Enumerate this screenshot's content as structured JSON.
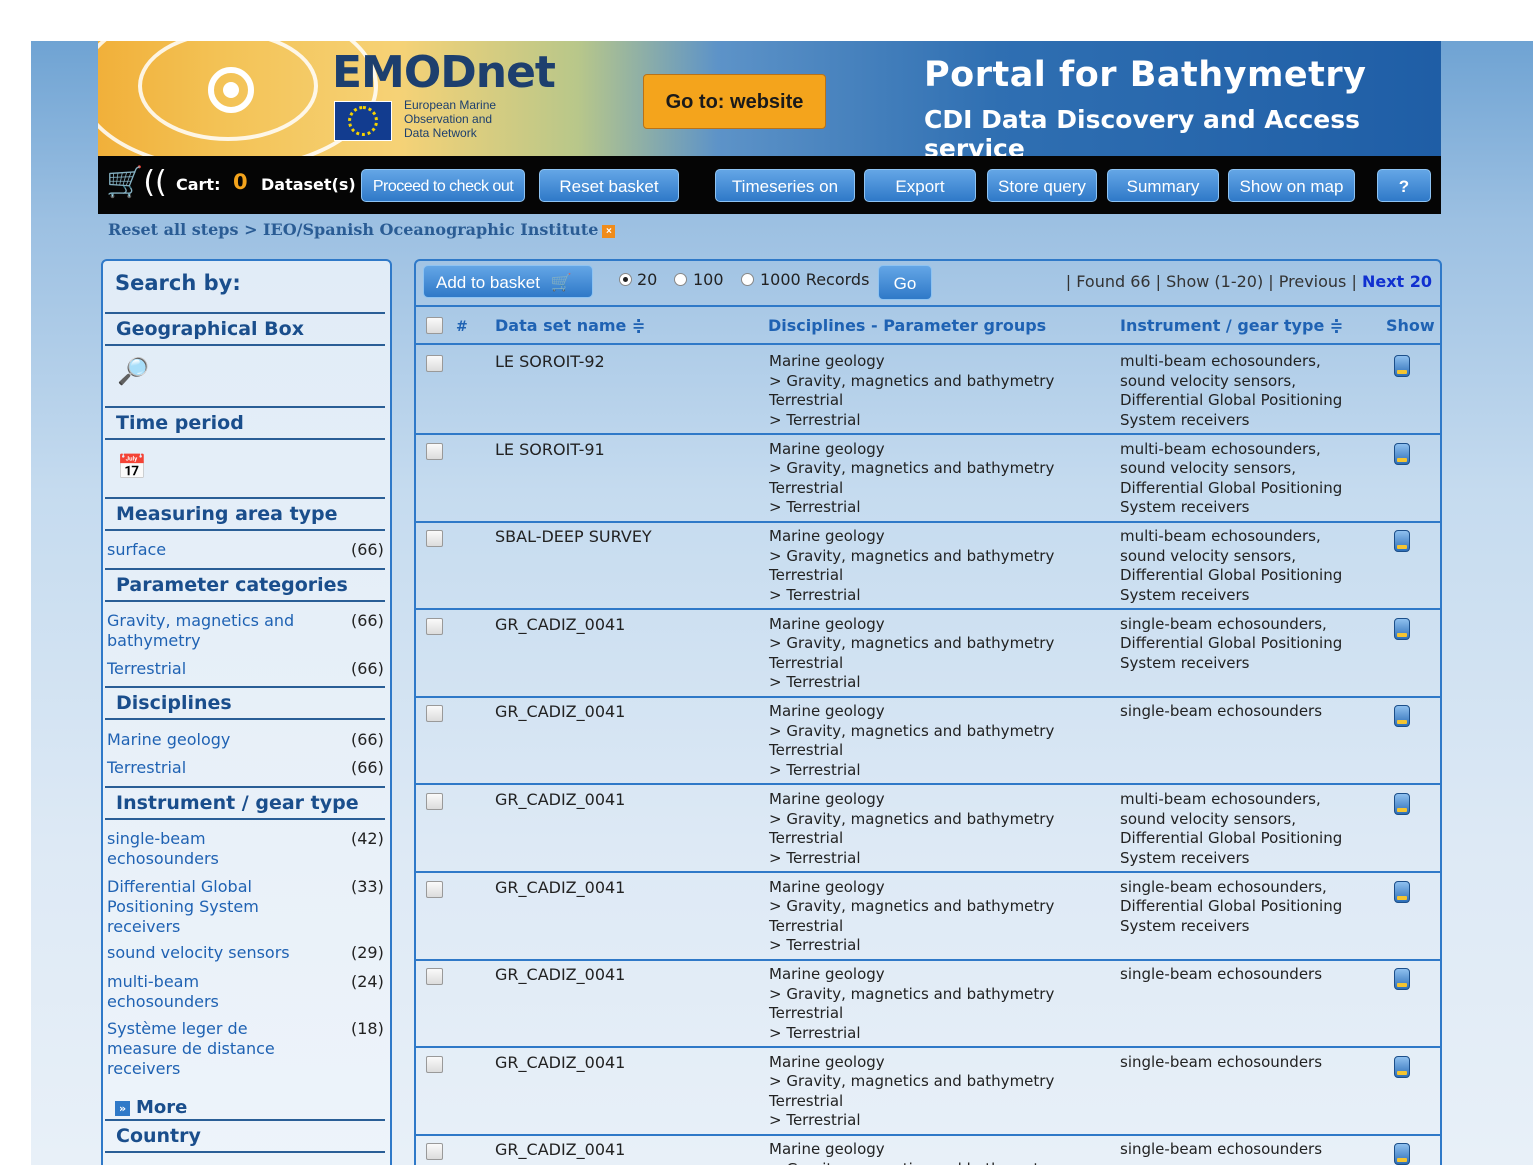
{
  "header": {
    "brand": "EMODnet",
    "brand_sub": "European Marine\nObservation and\nData Network",
    "goto_label": "Go to: website",
    "portal_title": "Portal for Bathymetry",
    "portal_sub": "CDI Data Discovery and Access service"
  },
  "toolbar": {
    "cart_label": "Cart:",
    "cart_count": "0",
    "datasets_label": "Dataset(s)",
    "buttons": [
      "Proceed to check out",
      "Reset basket",
      "Timeseries on",
      "Export",
      "Store query",
      "Summary",
      "Show on map",
      "?"
    ]
  },
  "breadcrumb": "Reset all steps > IEO/Spanish Oceanographic Institute",
  "sidebar": {
    "title": "Search by:",
    "geo_box": "Geographical Box",
    "time_period": "Time period",
    "measuring_area": "Measuring area type",
    "measuring_items": [
      {
        "label": "surface",
        "count": "(66)"
      }
    ],
    "param_categories": "Parameter categories",
    "param_items": [
      {
        "label": "Gravity, magnetics and\nbathymetry",
        "count": "(66)"
      },
      {
        "label": "Terrestrial",
        "count": "(66)"
      }
    ],
    "disciplines": "Disciplines",
    "discipline_items": [
      {
        "label": "Marine geology",
        "count": "(66)"
      },
      {
        "label": "Terrestrial",
        "count": "(66)"
      }
    ],
    "instrument": "Instrument / gear type",
    "instrument_items": [
      {
        "label": "single-beam\nechosounders",
        "count": "(42)"
      },
      {
        "label": "Differential Global\nPositioning System\nreceivers",
        "count": "(33)"
      },
      {
        "label": "sound velocity sensors",
        "count": "(29)"
      },
      {
        "label": "multi-beam\nechosounders",
        "count": "(24)"
      },
      {
        "label": "Système leger de\nmeasure de distance\nreceivers",
        "count": "(18)"
      }
    ],
    "more": "More",
    "country": "Country"
  },
  "results": {
    "add_basket": "Add to basket",
    "records": [
      {
        "label": "20",
        "selected": true
      },
      {
        "label": "100",
        "selected": false
      },
      {
        "label": "1000 Records",
        "selected": false
      }
    ],
    "go": "Go",
    "paging_found": "| Found 66 | Show  (1-20) | Previous |",
    "paging_next": "Next 20",
    "columns": {
      "num": "#",
      "name": "Data set name ≑",
      "disc": "Disciplines - Parameter groups",
      "inst": "Instrument / gear type ≑",
      "show": "Show"
    },
    "rows": [
      {
        "name": "LE SOROIT-92",
        "disc": "Marine geology\n> Gravity, magnetics and bathymetry\nTerrestrial\n> Terrestrial",
        "inst": "multi-beam echosounders,\nsound velocity sensors,\nDifferential Global Positioning\nSystem receivers"
      },
      {
        "name": "LE SOROIT-91",
        "disc": "Marine geology\n> Gravity, magnetics and bathymetry\nTerrestrial\n> Terrestrial",
        "inst": "multi-beam echosounders,\nsound velocity sensors,\nDifferential Global Positioning\nSystem receivers"
      },
      {
        "name": "SBAL-DEEP SURVEY",
        "disc": "Marine geology\n> Gravity, magnetics and bathymetry\nTerrestrial\n> Terrestrial",
        "inst": "multi-beam echosounders,\nsound velocity sensors,\nDifferential Global Positioning\nSystem receivers"
      },
      {
        "name": "GR_CADIZ_0041",
        "disc": "Marine geology\n> Gravity, magnetics and bathymetry\nTerrestrial\n> Terrestrial",
        "inst": "single-beam echosounders,\nDifferential Global Positioning\nSystem receivers"
      },
      {
        "name": "GR_CADIZ_0041",
        "disc": "Marine geology\n> Gravity, magnetics and bathymetry\nTerrestrial\n> Terrestrial",
        "inst": "single-beam echosounders"
      },
      {
        "name": "GR_CADIZ_0041",
        "disc": "Marine geology\n> Gravity, magnetics and bathymetry\nTerrestrial\n> Terrestrial",
        "inst": "multi-beam echosounders,\nsound velocity sensors,\nDifferential Global Positioning\nSystem receivers"
      },
      {
        "name": "GR_CADIZ_0041",
        "disc": "Marine geology\n> Gravity, magnetics and bathymetry\nTerrestrial\n> Terrestrial",
        "inst": "single-beam echosounders,\nDifferential Global Positioning\nSystem receivers"
      },
      {
        "name": "GR_CADIZ_0041",
        "disc": "Marine geology\n> Gravity, magnetics and bathymetry\nTerrestrial\n> Terrestrial",
        "inst": "single-beam echosounders"
      },
      {
        "name": "GR_CADIZ_0041",
        "disc": "Marine geology\n> Gravity, magnetics and bathymetry\nTerrestrial\n> Terrestrial",
        "inst": "single-beam echosounders"
      },
      {
        "name": "GR_CADIZ_0041",
        "disc": "Marine geology\n> Gravity, magnetics and bathymetry",
        "inst": "single-beam echosounders"
      }
    ]
  },
  "colors": {
    "accent": "#2f79c8",
    "link": "#1f62b3",
    "cart_count": "#f4a41c",
    "next": "#1030d0"
  }
}
